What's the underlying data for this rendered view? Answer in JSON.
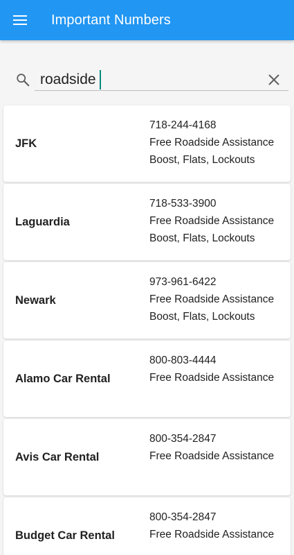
{
  "app_bar": {
    "title": "Important Numbers",
    "menu_icon": "hamburger-menu-icon",
    "color": "#2196f3"
  },
  "search": {
    "value": "roadside",
    "search_icon": "search-icon",
    "clear_icon": "close-icon"
  },
  "contacts": [
    {
      "name": "JFK",
      "phone": "718-244-4168",
      "service": "Free Roadside Assistance",
      "details": "Boost, Flats, Lockouts"
    },
    {
      "name": "Laguardia",
      "phone": "718-533-3900",
      "service": "Free Roadside Assistance",
      "details": "Boost, Flats, Lockouts"
    },
    {
      "name": "Newark",
      "phone": "973-961-6422",
      "service": "Free Roadside Assistance",
      "details": "Boost, Flats, Lockouts"
    },
    {
      "name": "Alamo Car Rental",
      "phone": "800-803-4444",
      "service": "Free Roadside Assistance",
      "details": ""
    },
    {
      "name": "Avis Car Rental",
      "phone": "800-354-2847",
      "service": "Free Roadside Assistance",
      "details": ""
    },
    {
      "name": "Budget Car Rental",
      "phone": "800-354-2847",
      "service": "Free Roadside Assistance",
      "details": ""
    }
  ]
}
